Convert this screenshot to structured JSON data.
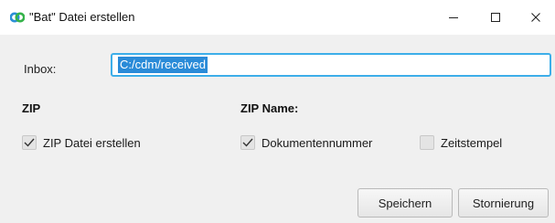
{
  "window": {
    "title": "\"Bat\" Datei erstellen",
    "app_icon": "bat-app-icon",
    "controls": [
      "minimize-icon",
      "maximize-icon",
      "close-icon"
    ]
  },
  "form": {
    "inbox_label": "Inbox:",
    "inbox_value": "C:/cdm/received",
    "zip_heading": "ZIP",
    "zip_name_heading": "ZIP Name:",
    "checkboxes": {
      "zip_create": {
        "label": "ZIP Datei erstellen",
        "checked": true
      },
      "document_number": {
        "label": "Dokumentennummer",
        "checked": true
      },
      "timestamp": {
        "label": "Zeitstempel",
        "checked": false
      }
    }
  },
  "buttons": {
    "save_label": "Speichern",
    "cancel_label": "Stornierung"
  },
  "colors": {
    "focus_border": "#3daee9",
    "selection": "#2a8bd8",
    "icon_green": "#35b34a",
    "icon_blue": "#2b8fd6"
  }
}
